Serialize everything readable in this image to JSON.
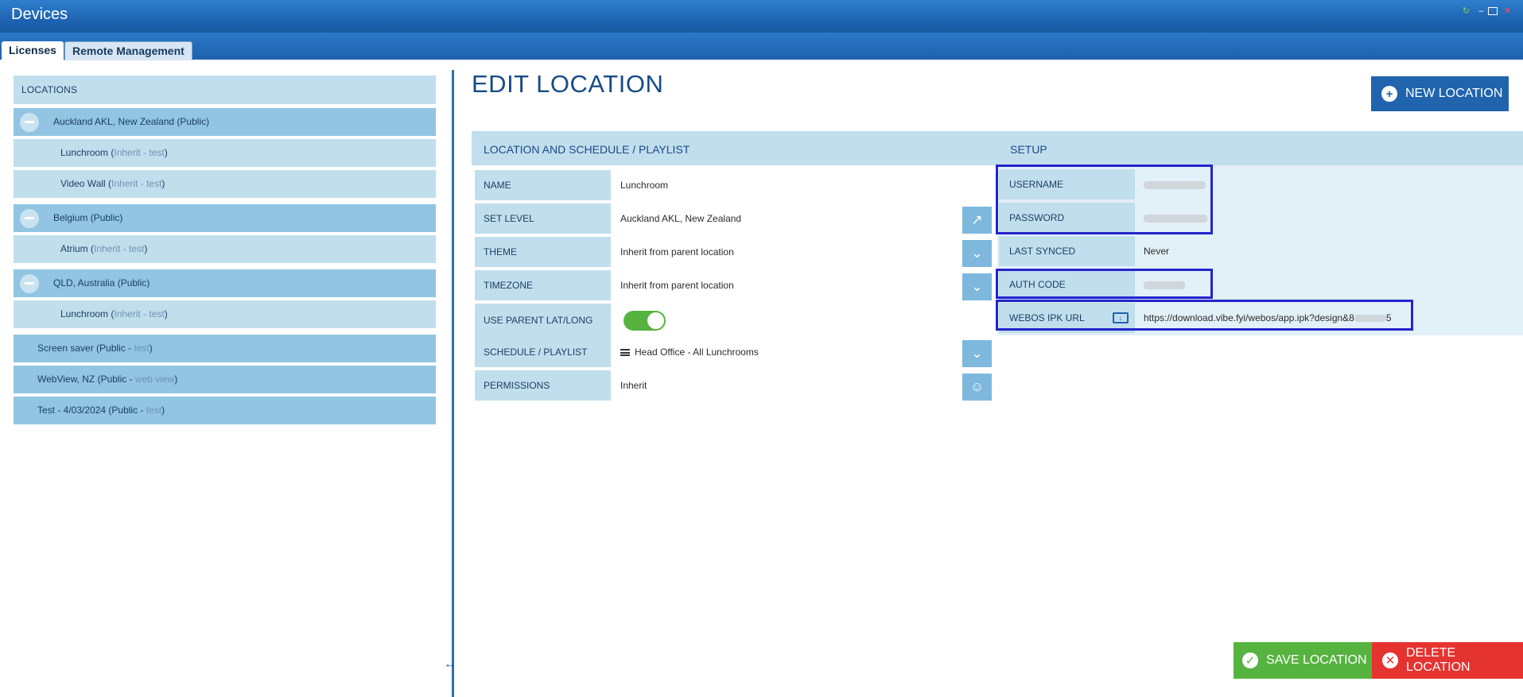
{
  "window": {
    "title": "Devices"
  },
  "tabs": [
    {
      "label": "Licenses",
      "active": true
    },
    {
      "label": "Remote Management",
      "active": false
    }
  ],
  "tree": {
    "header": "LOCATIONS",
    "items": [
      {
        "name": "Auckland AKL, New Zealand (Public)"
      },
      {
        "name": "Lunchroom (",
        "inherit": "Inherit",
        "sep": " - ",
        "tag": "test",
        "close": ")"
      },
      {
        "name": "Video Wall (",
        "inherit": "Inherit",
        "sep": " - ",
        "tag": "test",
        "close": ")"
      },
      {
        "name": "Belgium (Public)"
      },
      {
        "name": "Atrium (",
        "inherit": "Inherit",
        "sep": " - ",
        "tag": "test",
        "close": ")"
      },
      {
        "name": "QLD, Australia (Public)"
      },
      {
        "name": "Lunchroom (",
        "inherit": "Inherit",
        "sep": " - ",
        "tag": "test",
        "close": ")"
      },
      {
        "name": "Screen saver (Public - ",
        "tag": "test",
        "close": ")"
      },
      {
        "name": "WebView, NZ (Public - ",
        "tag": "web view",
        "close": ")"
      },
      {
        "name": "Test - 4/03/2024 (Public - ",
        "tag": "test",
        "close": ")"
      }
    ]
  },
  "main": {
    "title": "EDIT LOCATION",
    "new_button": "NEW LOCATION",
    "save_button": "SAVE LOCATION",
    "delete_button": "DELETE LOCATION",
    "section_left": "LOCATION AND SCHEDULE / PLAYLIST",
    "section_right": "SETUP",
    "fields": {
      "name": {
        "label": "NAME",
        "value": "Lunchroom"
      },
      "set_level": {
        "label": "SET LEVEL",
        "value": "Auckland AKL, New Zealand"
      },
      "theme": {
        "label": "THEME",
        "value": "Inherit from parent location"
      },
      "timezone": {
        "label": "TIMEZONE",
        "value": "Inherit from parent location"
      },
      "use_parent": {
        "label": "USE PARENT LAT/LONG",
        "on": true
      },
      "schedule": {
        "label": "SCHEDULE / PLAYLIST",
        "value": "Head Office - All Lunchrooms"
      },
      "permissions": {
        "label": "PERMISSIONS",
        "value": "Inherit"
      }
    },
    "setup": {
      "username": {
        "label": "USERNAME"
      },
      "password": {
        "label": "PASSWORD"
      },
      "last_synced": {
        "label": "LAST SYNCED",
        "value": "Never"
      },
      "auth_code": {
        "label": "AUTH CODE"
      },
      "webos_url": {
        "label": "WEBOS IPK URL",
        "value": "https://download.vibe.fyi/webos/app.ipk?design&8",
        "value_end": "5"
      }
    }
  },
  "colors": {
    "accent": "#1f64ad",
    "save": "#56b33f",
    "delete": "#e53330",
    "highlight_box": "#2424cc"
  },
  "icons": {
    "new": "plus-circle-icon",
    "save": "check-circle-icon",
    "delete": "x-circle-icon",
    "set_level_action": "share-icon",
    "dropdown": "chevron-down-icon",
    "permissions_action": "users-icon",
    "webos_download": "download-icon"
  }
}
